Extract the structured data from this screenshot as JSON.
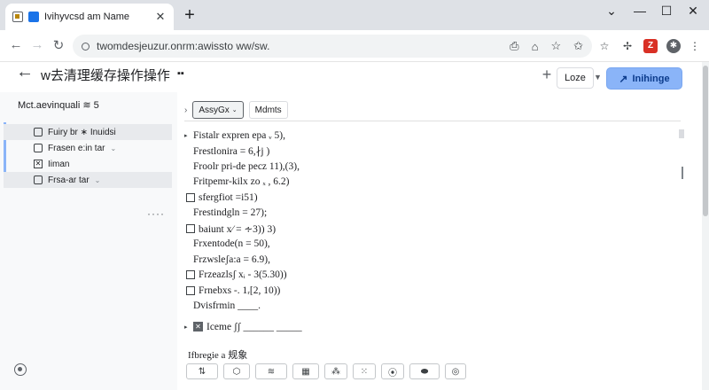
{
  "browser": {
    "tab_title": "Ivihyvcsd am Name",
    "new_tab_label": "+",
    "controls": {
      "minimize": "—",
      "maximize": "☐",
      "close": "✕",
      "chevron": "⌄"
    },
    "url": "twomdesjeuzur.onrm:awissto ww/sw."
  },
  "header": {
    "title": "w去清理缓存操作操作",
    "title_badge": "▪▪",
    "add_label": "+",
    "lozenge_label": "Loze",
    "primary_label": "Inihinge"
  },
  "sidebar": {
    "heading": "Mct.aevinquali ≋ 5",
    "items": [
      {
        "label": "Fuiry br ∗ Inuidsi",
        "checked": false
      },
      {
        "label": "Frasen e:in tar",
        "checked": false,
        "dropdown": "⌄"
      },
      {
        "label": "Iiman",
        "checked": true
      },
      {
        "label": "Frsa-ar tar",
        "checked": false,
        "dropdown": "⌄"
      }
    ],
    "more": "····"
  },
  "main": {
    "tabs": [
      {
        "label": "AssyGx",
        "dropdown": "⌄"
      },
      {
        "label": "Mdmts"
      }
    ],
    "lines": [
      {
        "text": "Fistalr expren epa ᵥ 5),",
        "prefix": "arrow"
      },
      {
        "text": "Frestlonira = 6,∤j )",
        "prefix": "none"
      },
      {
        "text": "Froolr pri-de pecz 11),(3),",
        "prefix": "none"
      },
      {
        "text": "Fritpemr-kilx zo  ₓ , 6.2)",
        "prefix": "none"
      },
      {
        "text": "sfergfiot =i51)",
        "prefix": "box"
      },
      {
        "text": "Frestindgln = 27);",
        "prefix": "none"
      },
      {
        "text": "baiunt x⁄ = ∻3)) 3)",
        "prefix": "box"
      },
      {
        "text": "Frxentode(n = 50),",
        "prefix": "none"
      },
      {
        "text": "Frzwsleʃa:a = 6.9),",
        "prefix": "none"
      },
      {
        "text": "Frzeazlsʃ xᵢ - 3(5.30))",
        "prefix": "box"
      },
      {
        "text": "Frnebxs -. 1ᵣ[2, 10))",
        "prefix": "box"
      },
      {
        "text": "Dvisfrmin ____.",
        "prefix": "none"
      },
      {
        "text": "Iceme ʃʃ ______ _____",
        "prefix": "boxsel"
      }
    ],
    "section_label": "Ifbregie a 规象",
    "icon_buttons": [
      "⇅",
      "⬡",
      "≋",
      "▦",
      "⁂",
      "⁙",
      "⦿",
      "⬬",
      "◎"
    ]
  }
}
